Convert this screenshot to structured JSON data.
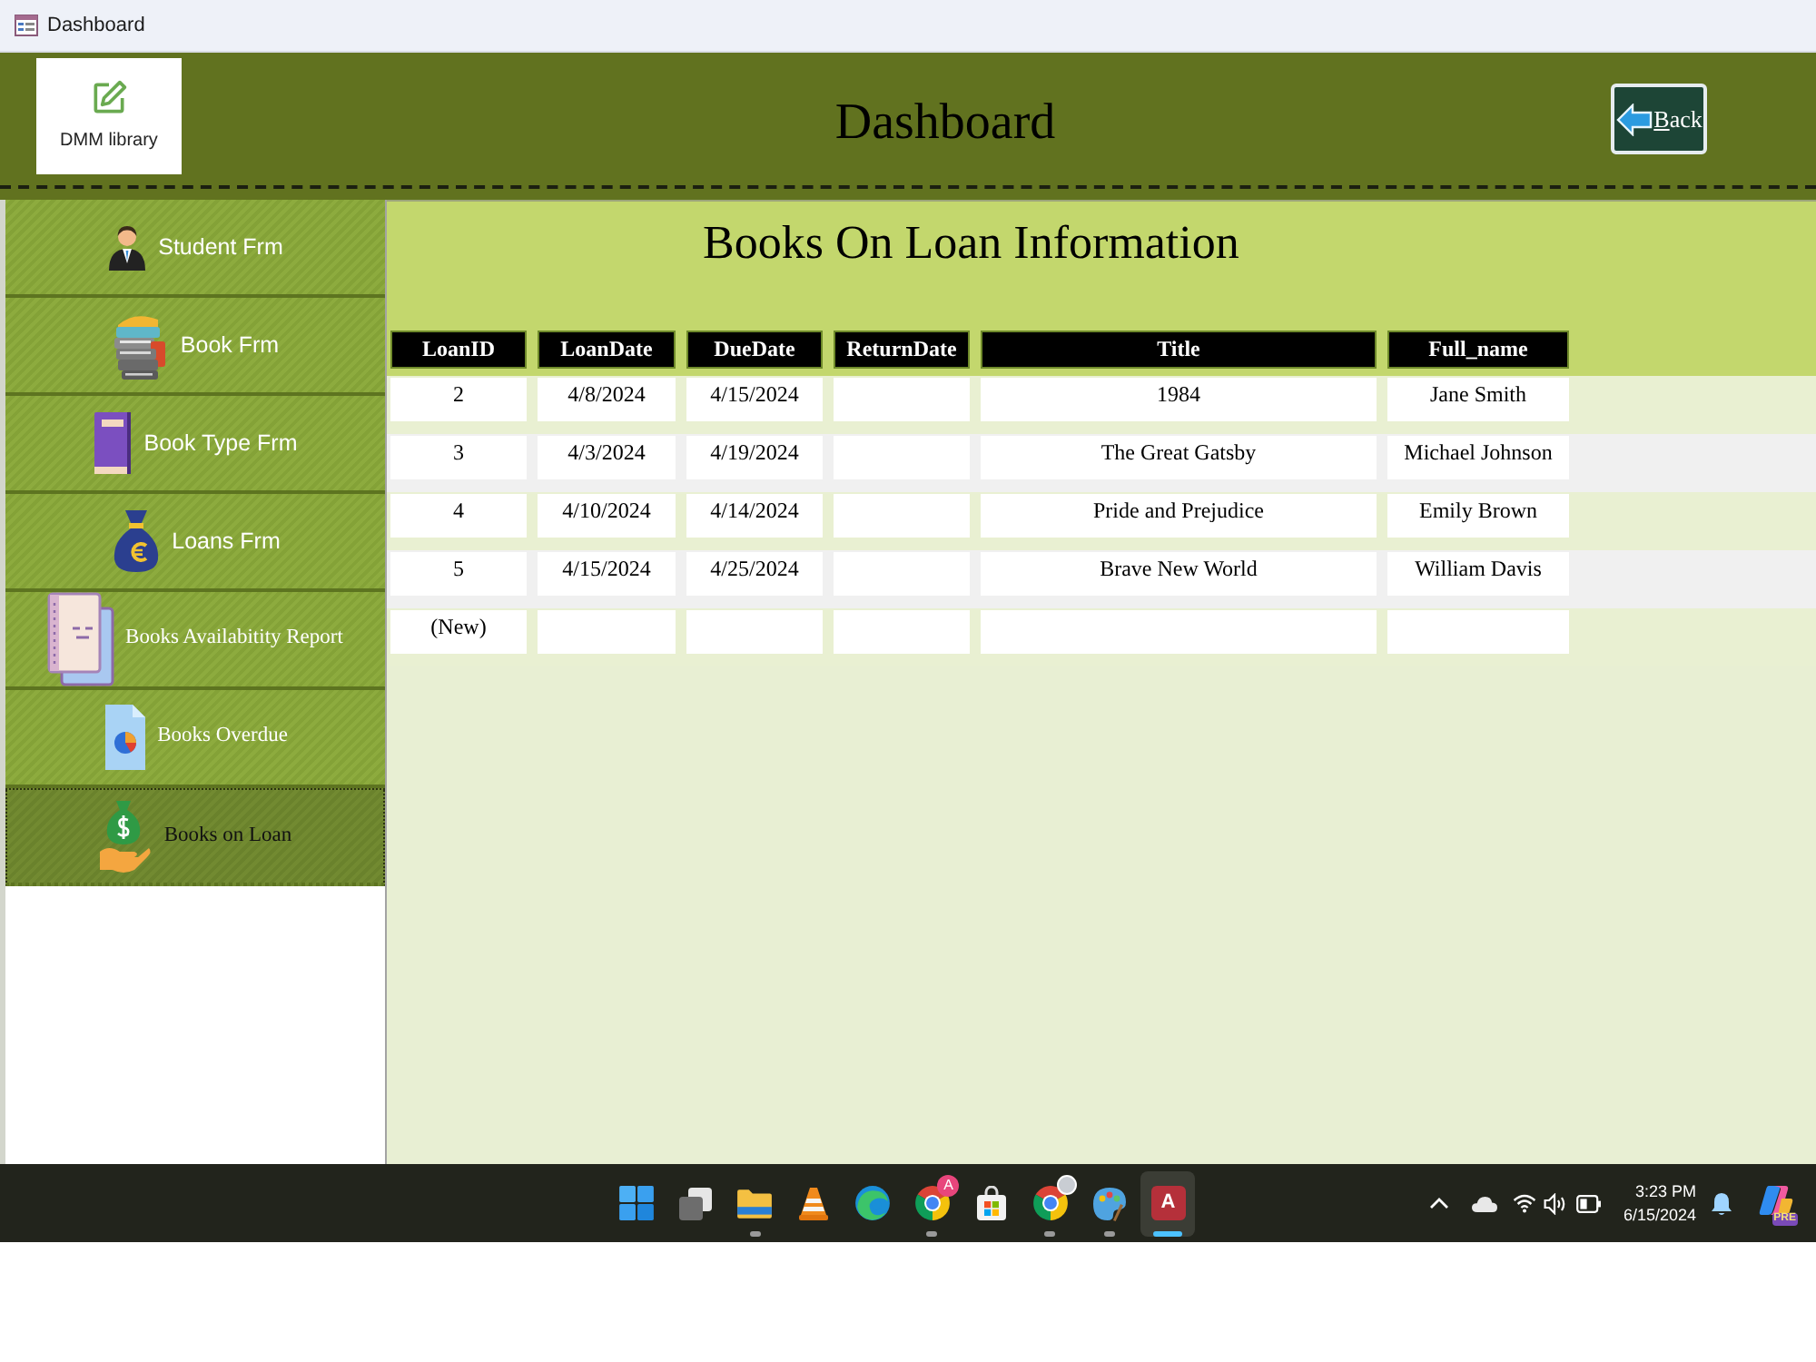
{
  "window": {
    "title": "Dashboard"
  },
  "header": {
    "logo_text": "DMM library",
    "title": "Dashboard",
    "back_button": "Back"
  },
  "sidebar": {
    "items": [
      {
        "label": "Student Frm",
        "kind": "form",
        "selected": false
      },
      {
        "label": "Book Frm",
        "kind": "form",
        "selected": false
      },
      {
        "label": "Book Type Frm",
        "kind": "form",
        "selected": false
      },
      {
        "label": "Loans Frm",
        "kind": "form",
        "selected": false
      },
      {
        "label": "Books Availabitity Report",
        "kind": "report",
        "selected": false
      },
      {
        "label": "Books Overdue",
        "kind": "report",
        "selected": false
      },
      {
        "label": "Books on Loan",
        "kind": "report",
        "selected": true
      }
    ]
  },
  "content": {
    "title": "Books On Loan Information",
    "table": {
      "columns": [
        "LoanID",
        "LoanDate",
        "DueDate",
        "ReturnDate",
        "Title",
        "Full_name"
      ],
      "rows": [
        {
          "cells": [
            "2",
            "4/8/2024",
            "4/15/2024",
            null,
            "1984",
            "Jane Smith"
          ]
        },
        {
          "cells": [
            "3",
            "4/3/2024",
            "4/19/2024",
            null,
            "The Great Gatsby",
            "Michael Johnson"
          ]
        },
        {
          "cells": [
            "4",
            "4/10/2024",
            "4/14/2024",
            null,
            "Pride and Prejudice",
            "Emily Brown"
          ]
        },
        {
          "cells": [
            "5",
            "4/15/2024",
            "4/25/2024",
            null,
            "Brave New World",
            "William Davis"
          ]
        }
      ],
      "new_record": "(New)"
    }
  },
  "taskbar": {
    "apps": [
      {
        "running": false,
        "selected": false
      },
      {
        "running": false,
        "selected": false
      },
      {
        "running": true,
        "selected": false
      },
      {
        "running": false,
        "selected": false
      },
      {
        "running": false,
        "selected": false
      },
      {
        "running": true,
        "selected": false,
        "badge": "A"
      },
      {
        "running": false,
        "selected": false
      },
      {
        "running": true,
        "selected": false
      },
      {
        "running": true,
        "selected": false
      },
      {
        "running": true,
        "selected": true,
        "letter": "A"
      }
    ],
    "tray": {
      "time": "3:23 PM",
      "date": "6/15/2024",
      "copilot_badge": "PRE"
    }
  }
}
